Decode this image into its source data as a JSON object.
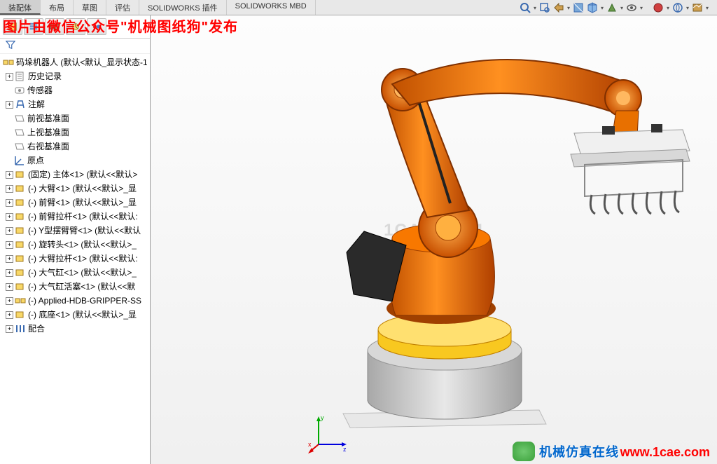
{
  "tabs": {
    "t0": "装配体",
    "t1": "布局",
    "t2": "草图",
    "t3": "评估",
    "t4": "SOLIDWORKS 插件",
    "t5": "SOLIDWORKS MBD"
  },
  "watermark": {
    "top": "图片由微信公众号\"机械图纸狗\"发布",
    "center": "1CAE.COM",
    "bottom_right": "www.1cae.com",
    "chat_text": "机械仿真在线"
  },
  "tree": {
    "root": "码垛机器人  (默认<默认_显示状态-1",
    "items": {
      "i0": "历史记录",
      "i1": "传感器",
      "i2": "注解",
      "i3": "前视基准面",
      "i4": "上视基准面",
      "i5": "右视基准面",
      "i6": "原点",
      "i7": "(固定) 主体<1> (默认<<默认>",
      "i8": "(-) 大臂<1> (默认<<默认>_显",
      "i9": "(-) 前臂<1> (默认<<默认>_显",
      "i10": "(-) 前臂拉杆<1> (默认<<默认:",
      "i11": "(-) Y型摆臂臂<1> (默认<<默认",
      "i12": "(-) 旋转头<1> (默认<<默认>_",
      "i13": "(-) 大臂拉杆<1> (默认<<默认:",
      "i14": "(-) 大气缸<1> (默认<<默认>_",
      "i15": "(-) 大气缸活塞<1> (默认<<默",
      "i16": "(-) Applied-HDB-GRIPPER-SS",
      "i17": "(-) 底座<1> (默认<<默认>_显",
      "i18": "配合"
    }
  }
}
